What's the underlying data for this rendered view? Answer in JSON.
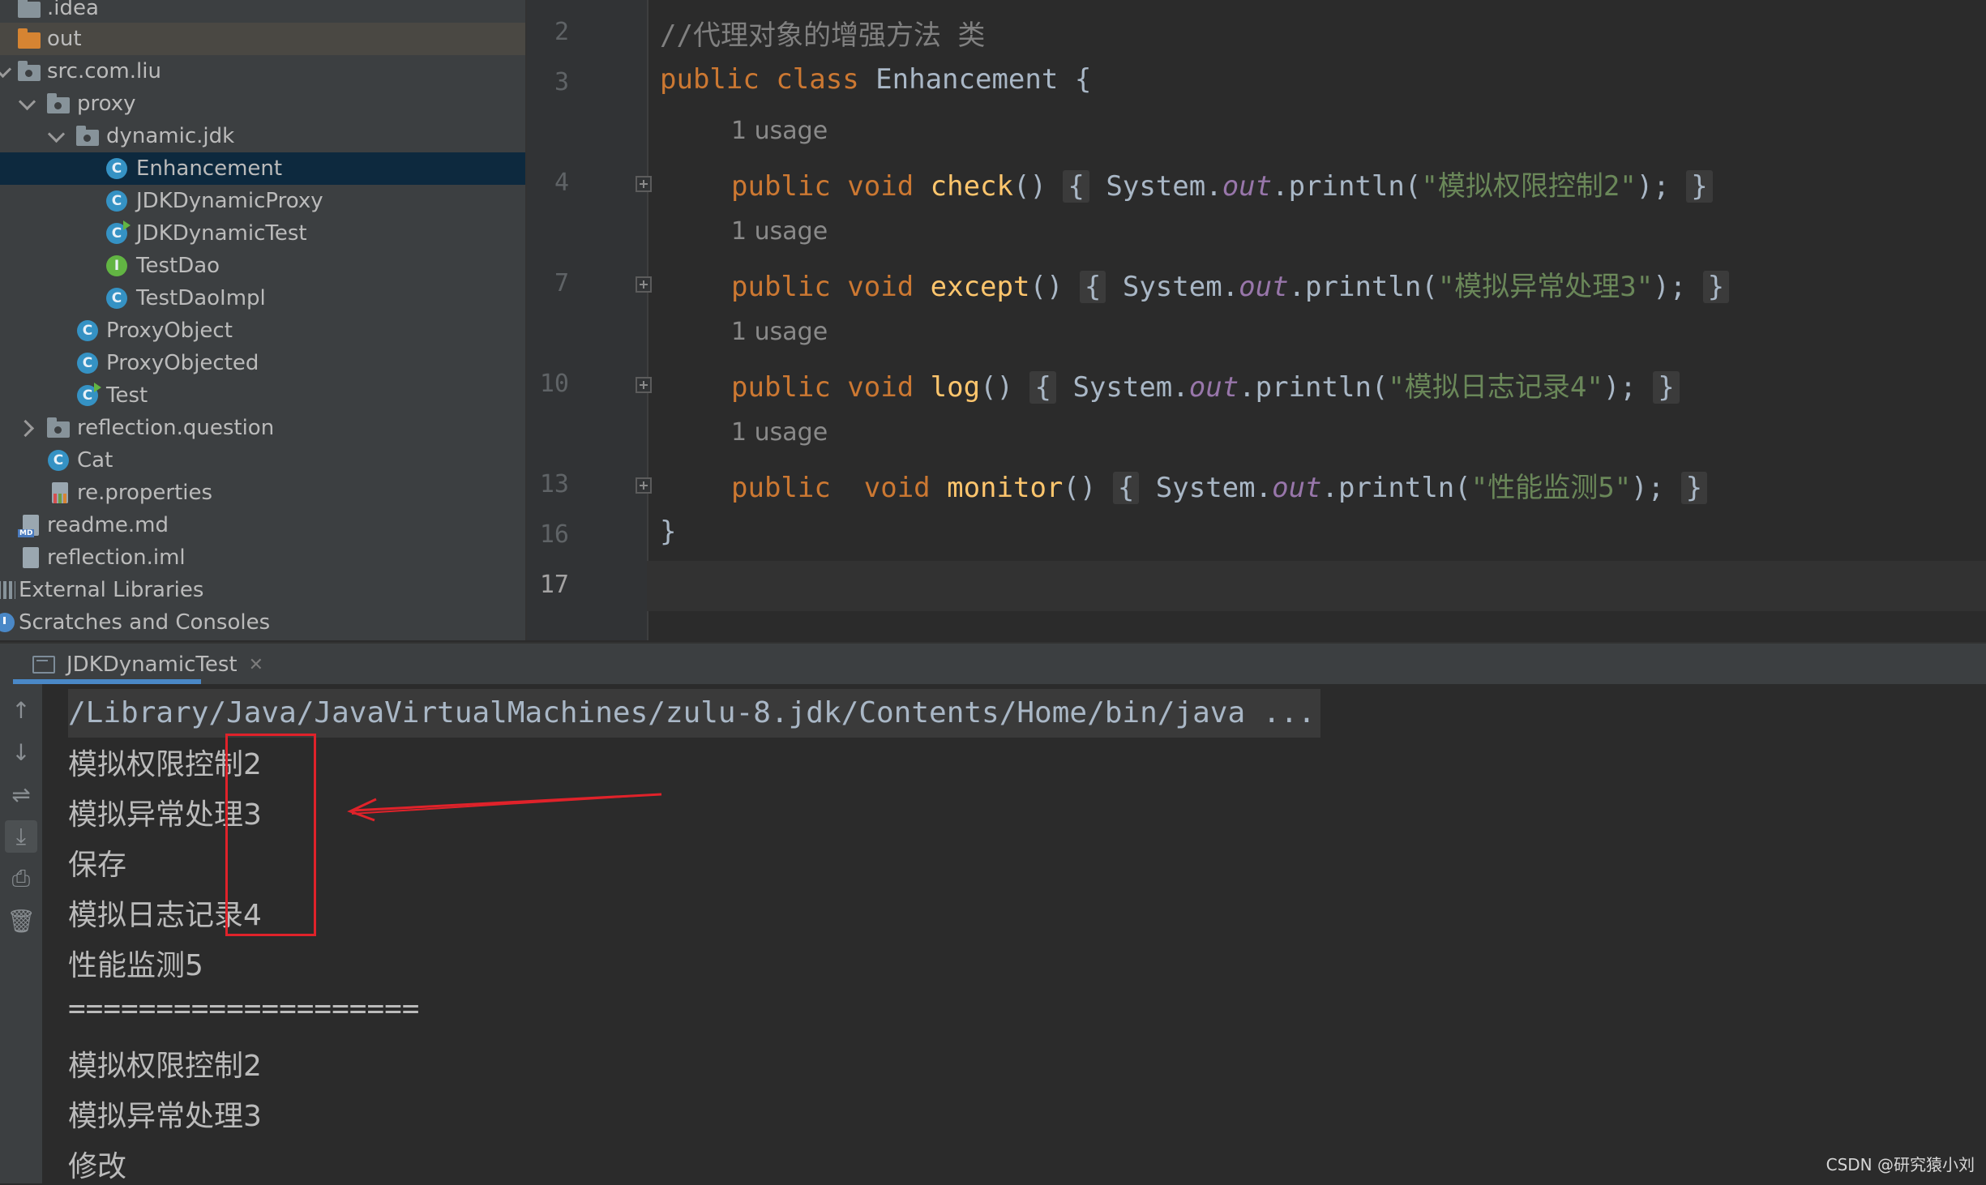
{
  "tree": {
    "items": [
      {
        "label": ".idea",
        "icon": "folder-icon"
      },
      {
        "label": "out",
        "icon": "folder-excluded-icon"
      },
      {
        "label": "src.com.liu",
        "icon": "source-folder-icon"
      },
      {
        "label": "proxy",
        "icon": "package-icon"
      },
      {
        "label": "dynamic.jdk",
        "icon": "package-icon"
      },
      {
        "label": "Enhancement",
        "icon": "class-icon"
      },
      {
        "label": "JDKDynamicProxy",
        "icon": "class-icon"
      },
      {
        "label": "JDKDynamicTest",
        "icon": "runnable-class-icon"
      },
      {
        "label": "TestDao",
        "icon": "interface-icon"
      },
      {
        "label": "TestDaoImpl",
        "icon": "class-icon"
      },
      {
        "label": "ProxyObject",
        "icon": "class-icon"
      },
      {
        "label": "ProxyObjected",
        "icon": "class-icon"
      },
      {
        "label": "Test",
        "icon": "runnable-class-icon"
      },
      {
        "label": "reflection.question",
        "icon": "package-icon"
      },
      {
        "label": "Cat",
        "icon": "class-icon"
      },
      {
        "label": "re.properties",
        "icon": "properties-file-icon"
      },
      {
        "label": "readme.md",
        "icon": "markdown-file-icon"
      },
      {
        "label": "reflection.iml",
        "icon": "module-file-icon"
      },
      {
        "label": "External Libraries",
        "icon": "libraries-icon"
      },
      {
        "label": "Scratches and Consoles",
        "icon": "scratches-icon"
      }
    ]
  },
  "editor": {
    "line_numbers": [
      "2",
      "3",
      "4",
      "7",
      "10",
      "13",
      "16",
      "17"
    ],
    "comment": "//代理对象的增强方法 类",
    "class_decl": {
      "kw1": "public",
      "kw2": "class",
      "name": "Enhancement",
      "brace": "{"
    },
    "usage_label": "1 usage",
    "methods": [
      {
        "mods": "public void ",
        "name": "check",
        "obj": "System.",
        "field": "out",
        "call": ".println(",
        "str": "\"模拟权限控制2\"",
        "tail": ");"
      },
      {
        "mods": "public void ",
        "name": "except",
        "obj": "System.",
        "field": "out",
        "call": ".println(",
        "str": "\"模拟异常处理3\"",
        "tail": ");"
      },
      {
        "mods": "public void ",
        "name": "log",
        "obj": "System.",
        "field": "out",
        "call": ".println(",
        "str": "\"模拟日志记录4\"",
        "tail": ");"
      },
      {
        "mods": "public  void ",
        "name": "monitor",
        "obj": "System.",
        "field": "out",
        "call": ".println(",
        "str": "\"性能监测5\"",
        "tail": ");"
      }
    ],
    "closing_brace": "}"
  },
  "run": {
    "tab_label": "JDKDynamicTest",
    "command": "/Library/Java/JavaVirtualMachines/zulu-8.jdk/Contents/Home/bin/java ...",
    "output": [
      "模拟权限控制2",
      "模拟异常处理3",
      "保存",
      "模拟日志记录4",
      "性能监测5",
      "====================",
      "模拟权限控制2",
      "模拟异常处理3",
      "修改"
    ]
  },
  "watermark": "CSDN @研究猿小刘",
  "colors": {
    "annotation": "#e0222a",
    "selection": "#0d293e",
    "keyword": "#cc7832",
    "string": "#6a8759"
  }
}
